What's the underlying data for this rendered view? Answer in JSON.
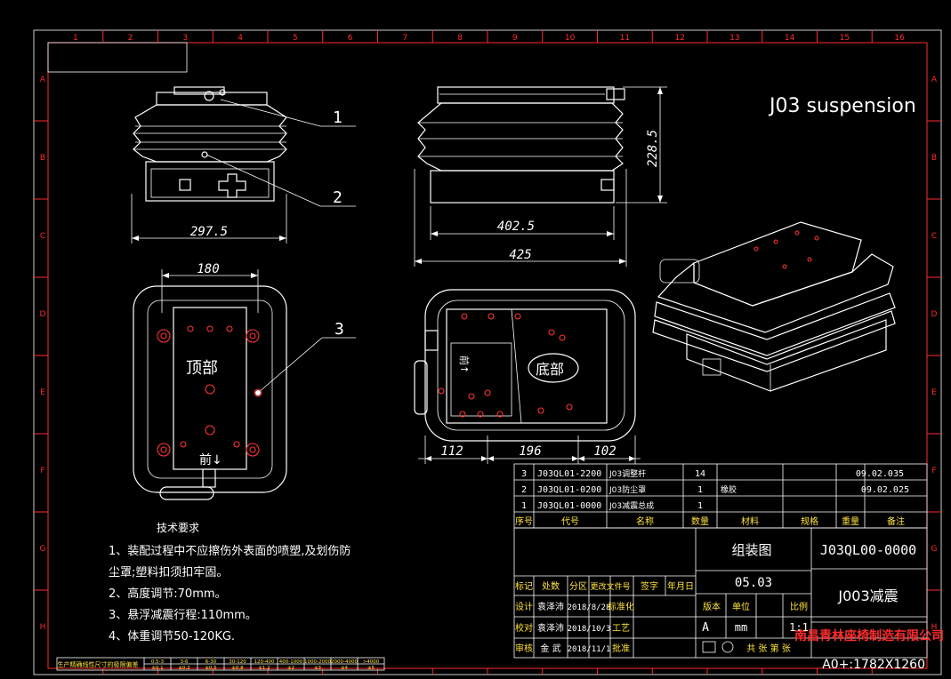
{
  "title_overlay": "J03 suspension",
  "grid_cols": [
    "1",
    "2",
    "3",
    "4",
    "5",
    "6",
    "7",
    "8",
    "9",
    "10",
    "11",
    "12",
    "13",
    "14",
    "15",
    "16"
  ],
  "grid_rows": [
    "A",
    "B",
    "C",
    "D",
    "E",
    "F",
    "G",
    "H"
  ],
  "dimensions": {
    "front_width": "297.5",
    "side_inner": "402.5",
    "side_outer": "425",
    "height": "228.5",
    "top_width": "180",
    "bottom_a": "112",
    "bottom_b": "196",
    "bottom_c": "102"
  },
  "balloons": [
    "1",
    "2",
    "3"
  ],
  "labels": {
    "top_view": "顶部",
    "bottom_view": "底部",
    "front_arrow": "前↓",
    "side_arrow": "前↑"
  },
  "tech": {
    "heading": "技术要求",
    "lines": [
      "1、装配过程中不应擦伤外表面的喷塑,及划伤防",
      "尘罩;塑料扣须扣牢固。",
      "2、高度调节:70mm。",
      "3、悬浮减震行程:110mm。",
      "4、体重调节50-120KG."
    ]
  },
  "bom": {
    "rows": [
      {
        "seq": "3",
        "code": "J03QL01-2200",
        "name": "J03调整杆",
        "qty": "14",
        "mat": "",
        "note": "09.02.035"
      },
      {
        "seq": "2",
        "code": "J03QL01-0200",
        "name": "J03防尘罩",
        "qty": "1",
        "mat": "橡胶",
        "note": "09.02.025"
      },
      {
        "seq": "1",
        "code": "J03QL01-0000",
        "name": "J03减震总成",
        "qty": "1",
        "mat": "",
        "note": ""
      }
    ],
    "header": [
      "序号",
      "代号",
      "名称",
      "数量",
      "材料",
      "规格",
      "重量",
      "备注"
    ]
  },
  "title_block": {
    "drawing_type": "组装图",
    "drawing_no": "J03QL00-0000",
    "version": "05.03",
    "part_name": "J003减震",
    "company": "南昌青林座椅制造有限公司",
    "paper": "A0+:1782X1260",
    "revision_header": [
      "标记",
      "处数",
      "分区",
      "更改文件号",
      "签字",
      "年月日"
    ],
    "people": [
      {
        "role": "设计",
        "name": "袁泽沛",
        "date": "2018/8/28",
        "role2": "标准化"
      },
      {
        "role": "校对",
        "name": "袁泽沛",
        "date": "2018/10/3",
        "role2": "工艺"
      },
      {
        "role": "审核",
        "name": "金 武",
        "date": "2018/11/1",
        "role2": "批准"
      }
    ],
    "stage_header": [
      "版本",
      "单位",
      "比例"
    ],
    "stage_values": [
      "A",
      "mm",
      "1:1"
    ],
    "sheet_text": "共 张 第 张"
  },
  "bottom_strip": {
    "label": "生产精确线性尺寸的极限偏差",
    "cells": [
      "0.5-3",
      "±0.1",
      "3-6",
      "±0.2",
      "6-30",
      "±0.5",
      "30-120",
      "±0.8",
      "120-400",
      "±1.2",
      "400-1000",
      "±2",
      "1000-2000",
      "±3",
      "2000-4000",
      "±4",
      ">4000",
      "±5"
    ]
  }
}
